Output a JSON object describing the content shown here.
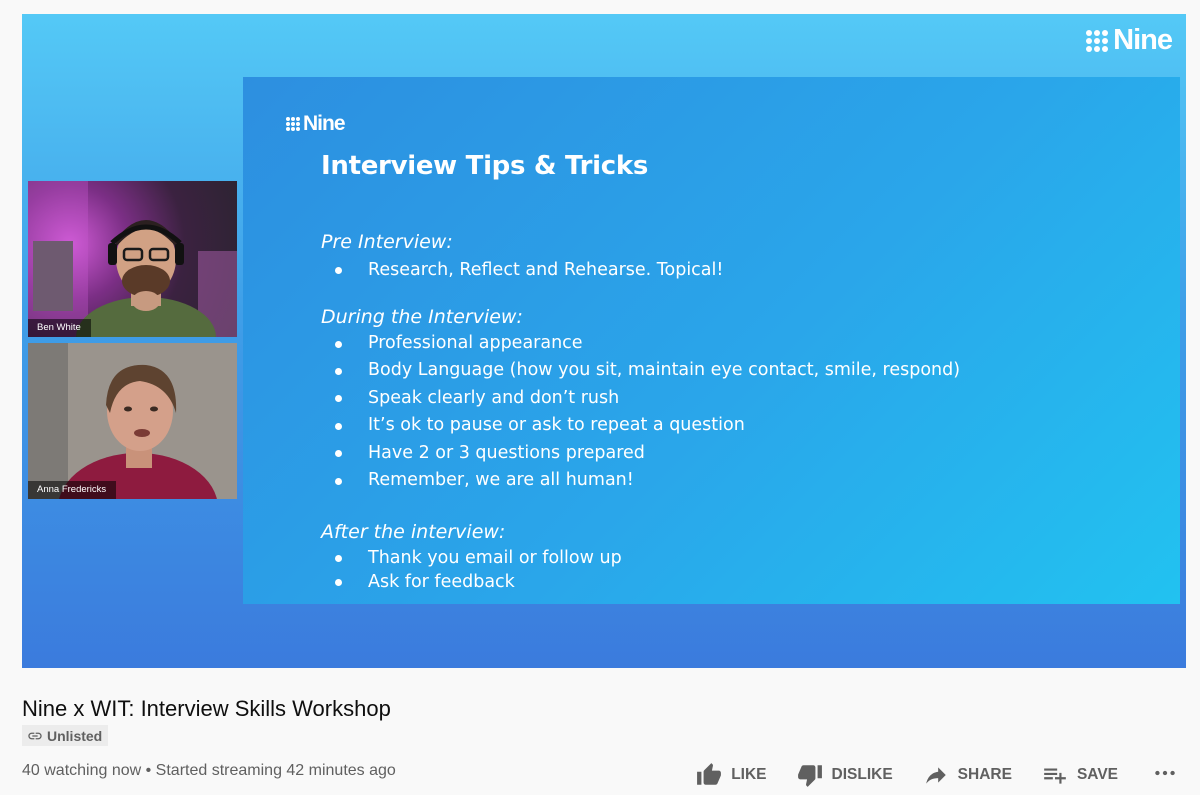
{
  "video": {
    "watermark_logo": "Nine",
    "slide": {
      "logo": "Nine",
      "title": "Interview Tips & Tricks",
      "sections": [
        {
          "heading": "Pre Interview:",
          "bullets": [
            "Research, Reflect and Rehearse. Topical!"
          ]
        },
        {
          "heading": "During the Interview:",
          "bullets": [
            "Professional appearance",
            "Body Language (how you sit, maintain eye contact, smile, respond)",
            "Speak clearly and don’t rush",
            "It’s ok to pause or ask to repeat a question",
            "Have 2 or 3 questions prepared",
            "Remember, we are all human!"
          ]
        },
        {
          "heading": "After the interview:",
          "bullets": [
            "Thank you email or follow up",
            "Ask for feedback"
          ]
        }
      ]
    },
    "participants": [
      {
        "name": "Ben White"
      },
      {
        "name": "Anna Fredericks"
      }
    ]
  },
  "meta": {
    "title": "Nine x WIT: Interview Skills Workshop",
    "badge": "Unlisted",
    "stats": "40 watching now • Started streaming 42 minutes ago"
  },
  "actions": {
    "like": "LIKE",
    "dislike": "DISLIKE",
    "share": "SHARE",
    "save": "SAVE"
  },
  "icons": {
    "like": "thumb-up-icon",
    "dislike": "thumb-down-icon",
    "share": "share-arrow-icon",
    "save": "playlist-add-icon",
    "more": "more-horizontal-icon",
    "badge": "link-icon"
  },
  "colors": {
    "video_top": "#54c9f6",
    "video_bottom": "#3b7bdd",
    "slide": "#2aa6ea",
    "text_secondary": "#606060"
  }
}
